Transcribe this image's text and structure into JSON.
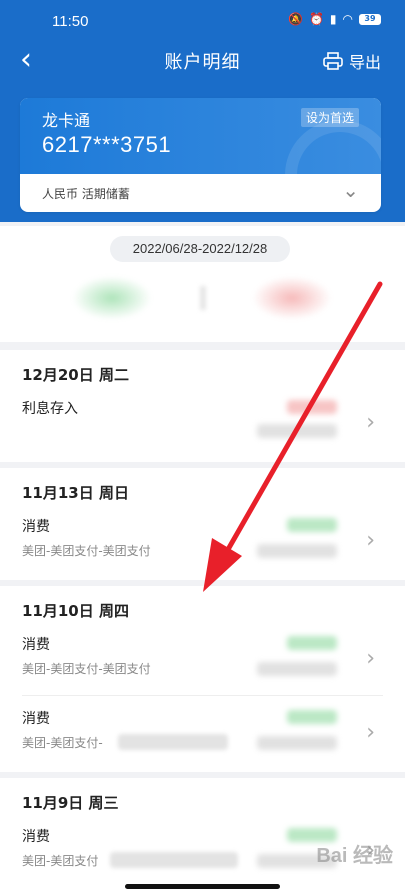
{
  "status": {
    "time": "11:50",
    "battery": "39"
  },
  "nav": {
    "title": "账户明细",
    "export_label": "导出"
  },
  "card": {
    "name": "龙卡通",
    "number": "6217***3751",
    "badge": "设为首选",
    "type": "人民币 活期储蓄"
  },
  "summary": {
    "date_range": "2022/06/28-2022/12/28"
  },
  "groups": [
    {
      "date": "12月20日 周二",
      "items": [
        {
          "title": "利息存入",
          "sub": ""
        }
      ]
    },
    {
      "date": "11月13日 周日",
      "items": [
        {
          "title": "消费",
          "sub": "美团-美团支付-美团支付"
        }
      ]
    },
    {
      "date": "11月10日 周四",
      "items": [
        {
          "title": "消费",
          "sub": "美团-美团支付-美团支付"
        },
        {
          "title": "消费",
          "sub": "美团-美团支付-"
        }
      ]
    },
    {
      "date": "11月9日 周三",
      "items": [
        {
          "title": "消费",
          "sub": "美团-美团支付"
        }
      ]
    }
  ],
  "watermark": "Bai 经验",
  "colors": {
    "brand": "#1a6dc9",
    "arrow": "#e8202a",
    "income": "#78d28c",
    "expense": "#f08c8c"
  }
}
